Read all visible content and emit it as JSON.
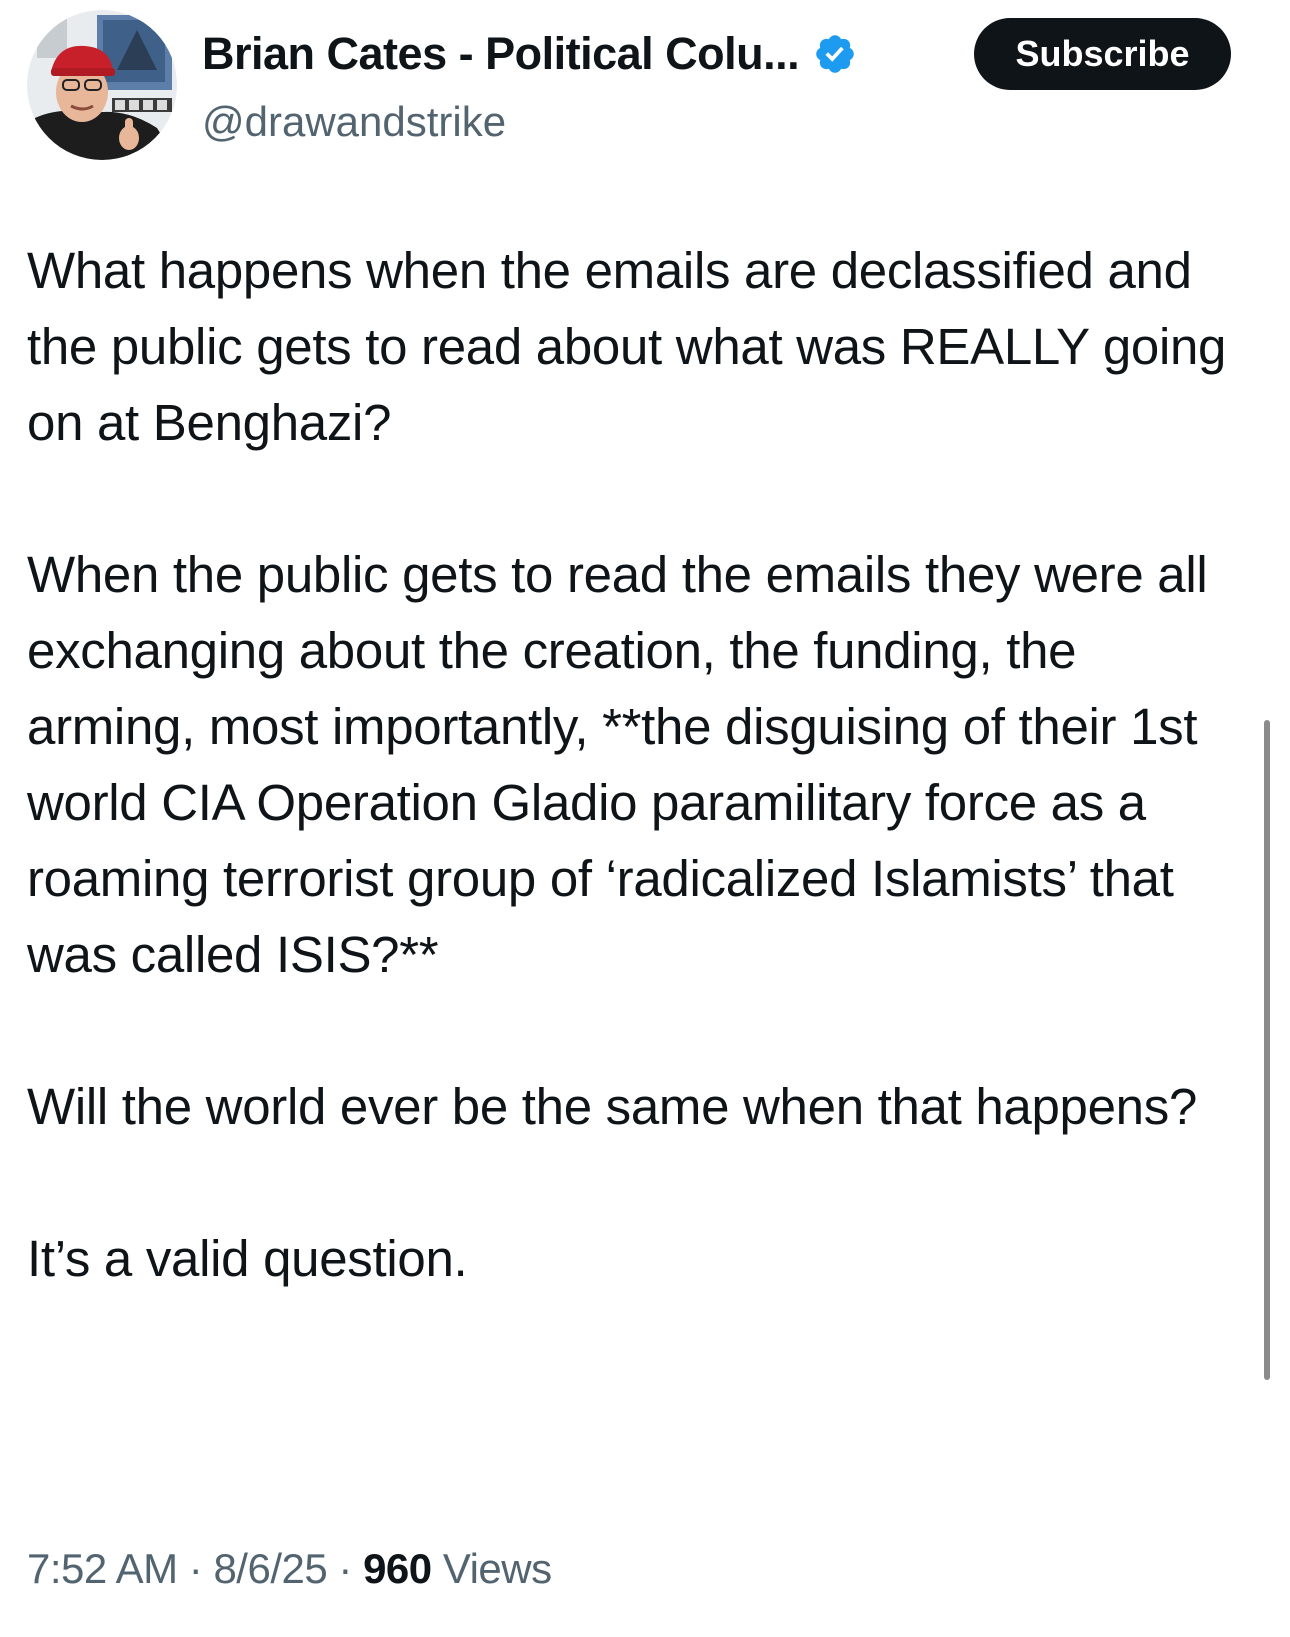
{
  "author": {
    "display_name": "Brian Cates - Political Colu...",
    "handle": "@drawandstrike",
    "verified_icon": "verified-badge-icon",
    "verified_color": "#1d9bf0"
  },
  "subscribe_label": "Subscribe",
  "tweet": {
    "paragraphs": [
      "What happens when the emails are declassified and the public gets to read about what was REALLY going on at Benghazi?",
      "When the public gets to read the emails they were all exchanging about the creation, the funding, the arming, most importantly, **the disguising of their 1st world CIA Operation Gladio paramilitary force as a roaming terrorist group of ‘radicalized Islamists’ that was called ISIS?**",
      "Will the world ever be the same when that happens?",
      "It’s a valid question."
    ]
  },
  "meta": {
    "time": "7:52 AM",
    "separator": "·",
    "date": "8/6/25",
    "views_count": "960",
    "views_label": "Views"
  }
}
